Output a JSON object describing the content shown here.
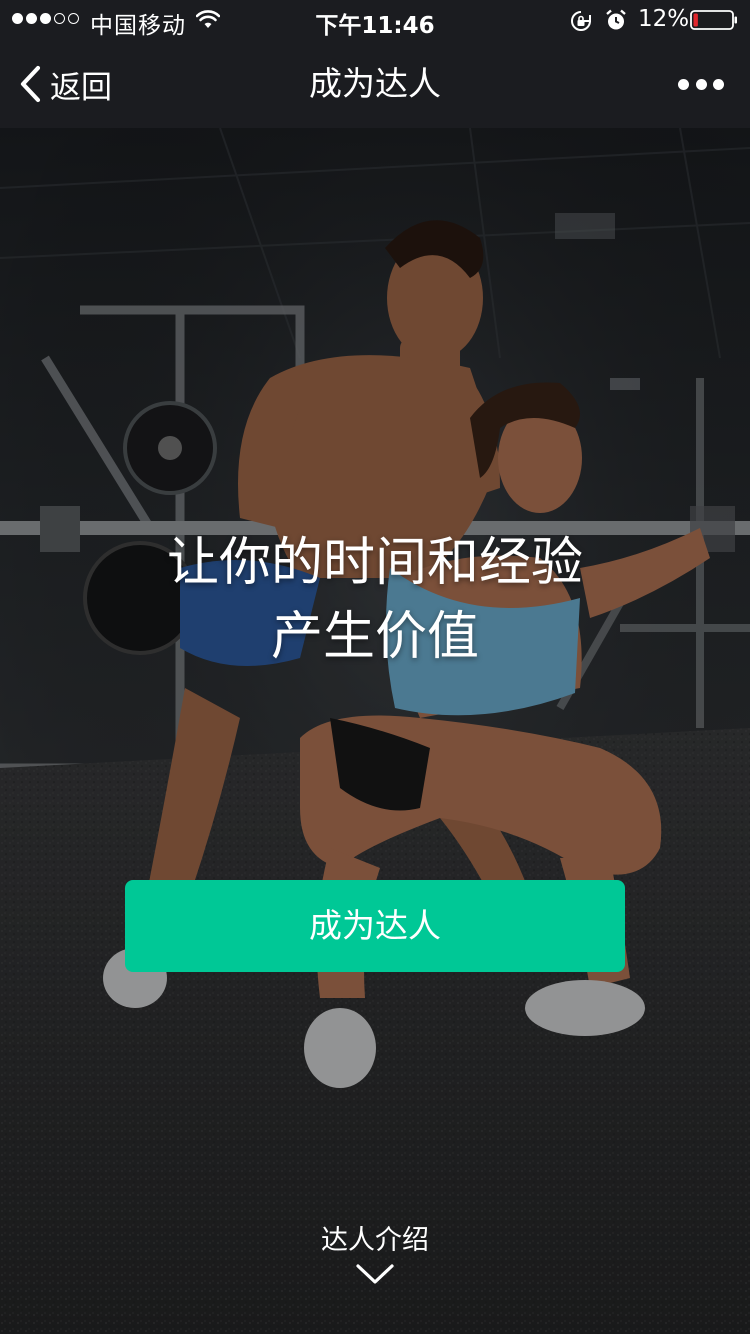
{
  "status_bar": {
    "carrier": "中国移动",
    "time": "下午11:46",
    "battery_percent": "12%",
    "battery_level": 0.12,
    "signal_bars_filled": 3,
    "signal_bars_total": 5,
    "icons": [
      "wifi-icon",
      "rotation-lock-icon",
      "alarm-icon",
      "battery-icon"
    ]
  },
  "nav": {
    "back_label": "返回",
    "title": "成为达人",
    "more_icon": "more-dots-icon"
  },
  "hero": {
    "headline_line1": "让你的时间和经验",
    "headline_line2": "产生价值",
    "cta_label": "成为达人",
    "intro_label": "达人介绍",
    "intro_icon": "chevron-down-icon"
  },
  "colors": {
    "cta": "#00c896",
    "bar_bg": "#1b1c20",
    "battery_low": "#e0262d"
  }
}
